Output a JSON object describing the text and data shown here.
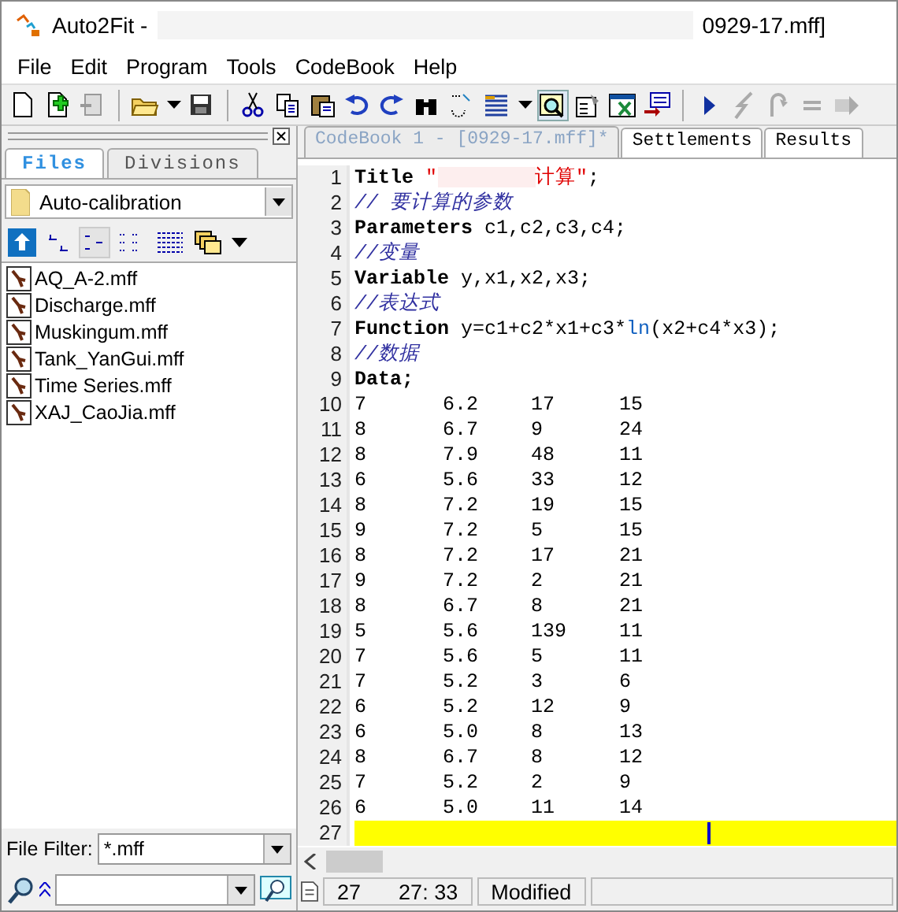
{
  "window": {
    "title": "Auto2Fit -",
    "title_tail": "0929-17.mff]"
  },
  "menu": [
    "File",
    "Edit",
    "Program",
    "Tools",
    "CodeBook",
    "Help"
  ],
  "side_panel": {
    "tabs": [
      {
        "label": "Files",
        "selected": true
      },
      {
        "label": "Divisions",
        "selected": false
      }
    ],
    "folder": "Auto-calibration",
    "files": [
      "AQ_A-2.mff",
      "Discharge.mff",
      "Muskingum.mff",
      "Tank_YanGui.mff",
      "Time Series.mff",
      "XAJ_CaoJia.mff"
    ],
    "filter_label": "File Filter:",
    "filter_value": "*.mff"
  },
  "editor": {
    "tabs": [
      {
        "label": "CodeBook 1 - [0929-17.mff]*",
        "selected": true
      },
      {
        "label": "Settlements",
        "selected": false
      },
      {
        "label": "Results",
        "selected": false
      }
    ],
    "lines": [
      {
        "number": "1",
        "kind": "code",
        "current": false,
        "tokens": [
          {
            "kind": "kw",
            "text": "Title "
          },
          {
            "kind": "str",
            "text": "\""
          },
          {
            "kind": "blur"
          },
          {
            "kind": "str",
            "text": "计算"
          },
          {
            "kind": "str",
            "text": "\""
          },
          {
            "kind": "plain",
            "text": ";"
          }
        ]
      },
      {
        "number": "2",
        "kind": "code",
        "current": false,
        "tokens": [
          {
            "kind": "comment",
            "text": "// 要计算的参数"
          }
        ]
      },
      {
        "number": "3",
        "kind": "code",
        "current": false,
        "tokens": [
          {
            "kind": "kw",
            "text": "Parameters "
          },
          {
            "kind": "plain",
            "text": "c1,c2,c3,c4;"
          }
        ]
      },
      {
        "number": "4",
        "kind": "code",
        "current": false,
        "tokens": [
          {
            "kind": "comment",
            "text": "//变量"
          }
        ]
      },
      {
        "number": "5",
        "kind": "code",
        "current": false,
        "tokens": [
          {
            "kind": "kw",
            "text": "Variable "
          },
          {
            "kind": "plain",
            "text": "y,x1,x2,x3;"
          }
        ]
      },
      {
        "number": "6",
        "kind": "code",
        "current": false,
        "tokens": [
          {
            "kind": "comment",
            "text": "//表达式"
          }
        ]
      },
      {
        "number": "7",
        "kind": "code",
        "current": false,
        "tokens": [
          {
            "kind": "kw",
            "text": "Function "
          },
          {
            "kind": "plain",
            "text": "y=c1+c2*x1+c3*"
          },
          {
            "kind": "fn",
            "text": "ln"
          },
          {
            "kind": "plain",
            "text": "(x2+c4*x3);"
          }
        ]
      },
      {
        "number": "8",
        "kind": "code",
        "current": false,
        "tokens": [
          {
            "kind": "comment",
            "text": "//数据"
          }
        ]
      },
      {
        "number": "9",
        "kind": "code",
        "current": false,
        "tokens": [
          {
            "kind": "kw",
            "text": "Data;"
          }
        ]
      },
      {
        "number": "10",
        "kind": "data",
        "current": false,
        "values": [
          "7",
          "6.2",
          "17",
          "15"
        ]
      },
      {
        "number": "11",
        "kind": "data",
        "current": false,
        "values": [
          "8",
          "6.7",
          "9",
          "24"
        ]
      },
      {
        "number": "12",
        "kind": "data",
        "current": false,
        "values": [
          "8",
          "7.9",
          "48",
          "11"
        ]
      },
      {
        "number": "13",
        "kind": "data",
        "current": false,
        "values": [
          "6",
          "5.6",
          "33",
          "12"
        ]
      },
      {
        "number": "14",
        "kind": "data",
        "current": false,
        "values": [
          "8",
          "7.2",
          "19",
          "15"
        ]
      },
      {
        "number": "15",
        "kind": "data",
        "current": false,
        "values": [
          "9",
          "7.2",
          "5",
          "15"
        ]
      },
      {
        "number": "16",
        "kind": "data",
        "current": false,
        "values": [
          "8",
          "7.2",
          "17",
          "21"
        ]
      },
      {
        "number": "17",
        "kind": "data",
        "current": false,
        "values": [
          "9",
          "7.2",
          "2",
          "21"
        ]
      },
      {
        "number": "18",
        "kind": "data",
        "current": false,
        "values": [
          "8",
          "6.7",
          "8",
          "21"
        ]
      },
      {
        "number": "19",
        "kind": "data",
        "current": false,
        "values": [
          "5",
          "5.6",
          "139",
          "11"
        ]
      },
      {
        "number": "20",
        "kind": "data",
        "current": false,
        "values": [
          "7",
          "5.6",
          "5",
          "11"
        ]
      },
      {
        "number": "21",
        "kind": "data",
        "current": false,
        "values": [
          "7",
          "5.2",
          "3",
          "6"
        ]
      },
      {
        "number": "22",
        "kind": "data",
        "current": false,
        "values": [
          "6",
          "5.2",
          "12",
          "9"
        ]
      },
      {
        "number": "23",
        "kind": "data",
        "current": false,
        "values": [
          "6",
          "5.0",
          "8",
          "13"
        ]
      },
      {
        "number": "24",
        "kind": "data",
        "current": false,
        "values": [
          "8",
          "6.7",
          "8",
          "12"
        ]
      },
      {
        "number": "25",
        "kind": "data",
        "current": false,
        "values": [
          "7",
          "5.2",
          "2",
          "9"
        ]
      },
      {
        "number": "26",
        "kind": "data",
        "current": false,
        "values": [
          "6",
          "5.0",
          "11",
          "14"
        ]
      },
      {
        "number": "27",
        "kind": "blank",
        "current": true
      }
    ]
  },
  "status_bar": {
    "line": "27",
    "position": "27: 33",
    "state": "Modified"
  }
}
